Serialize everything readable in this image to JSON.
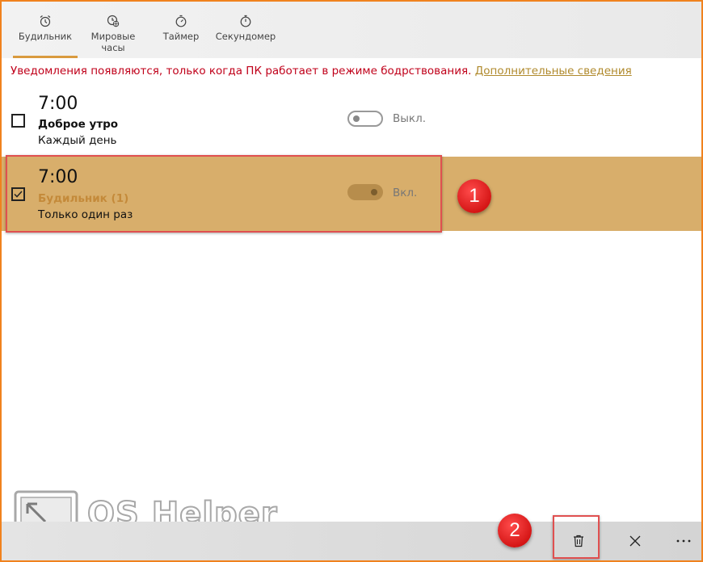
{
  "tabs": [
    {
      "label": "Будильник",
      "icon": "alarm-clock-icon",
      "active": true
    },
    {
      "label": "Мировые часы",
      "icon": "world-clock-icon",
      "active": false
    },
    {
      "label": "Таймер",
      "icon": "timer-icon",
      "active": false
    },
    {
      "label": "Секундомер",
      "icon": "stopwatch-icon",
      "active": false
    }
  ],
  "notice": {
    "text": "Уведомления появляются, только когда ПК работает в режиме бодрствования.",
    "link": "Дополнительные сведения"
  },
  "alarms": [
    {
      "time": "7:00",
      "name": "Доброе утро",
      "repeat": "Каждый день",
      "checked": false,
      "toggle_label": "Выкл."
    },
    {
      "time": "7:00",
      "name": "Будильник (1)",
      "repeat": "Только один раз",
      "checked": true,
      "toggle_label": "Вкл."
    }
  ],
  "annotations": {
    "step1": "1",
    "step2": "2"
  },
  "watermark": {
    "text": "OS Helper"
  },
  "colors": {
    "accent": "#d99a3e",
    "selected_row": "#d8ae6b",
    "notice_text": "#c0001a",
    "link": "#b08a2d",
    "annotation_red": "#e05050",
    "window_border": "#f0821e"
  },
  "toolbar": {
    "delete_icon": "trash-icon",
    "cancel_icon": "close-icon",
    "more_icon": "more-icon"
  }
}
